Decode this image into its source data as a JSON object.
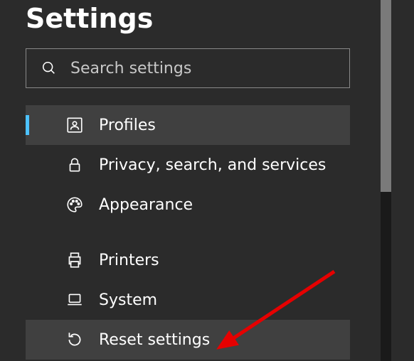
{
  "header": {
    "title": "Settings"
  },
  "search": {
    "placeholder": "Search settings",
    "value": ""
  },
  "nav": {
    "items": [
      {
        "id": "profiles",
        "label": "Profiles",
        "icon": "profiles-icon",
        "active": true,
        "highlighted": false
      },
      {
        "id": "privacy",
        "label": "Privacy, search, and services",
        "icon": "lock-icon",
        "active": false,
        "highlighted": false
      },
      {
        "id": "appearance",
        "label": "Appearance",
        "icon": "palette-icon",
        "active": false,
        "highlighted": false
      },
      {
        "id": "printers",
        "label": "Printers",
        "icon": "printer-icon",
        "active": false,
        "highlighted": false
      },
      {
        "id": "system",
        "label": "System",
        "icon": "laptop-icon",
        "active": false,
        "highlighted": false
      },
      {
        "id": "reset",
        "label": "Reset settings",
        "icon": "reset-icon",
        "active": false,
        "highlighted": true
      }
    ]
  },
  "annotation": {
    "arrow_color": "#e60000"
  }
}
